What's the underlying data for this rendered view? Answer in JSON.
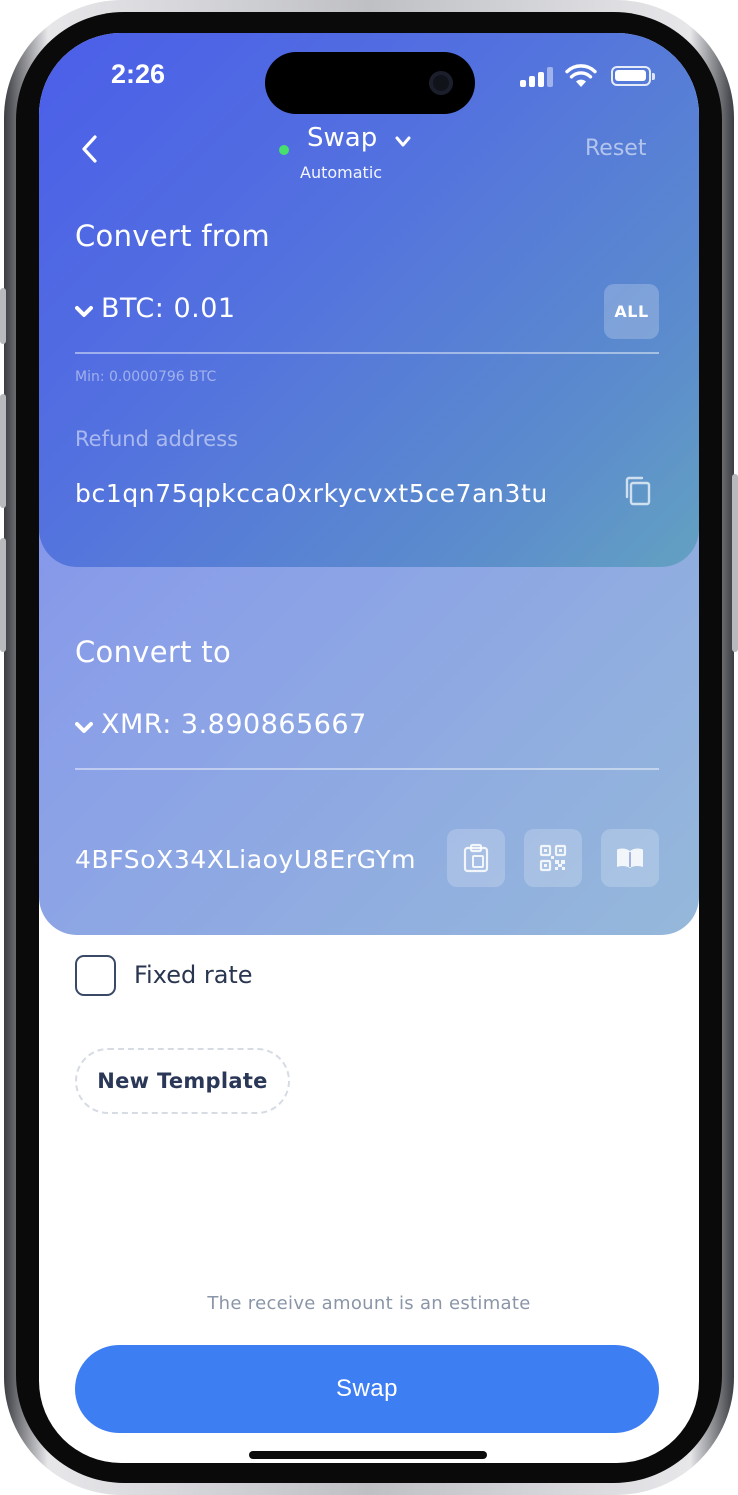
{
  "status_bar": {
    "time": "2:26"
  },
  "header": {
    "title": "Swap",
    "subtitle": "Automatic",
    "reset_label": "Reset",
    "status_color": "#47e06d"
  },
  "convert_from": {
    "title": "Convert from",
    "currency": "BTC",
    "amount_display": "BTC: 0.01",
    "all_label": "ALL",
    "min_text": "Min: 0.0000796 BTC",
    "refund_label": "Refund address",
    "refund_address": "bc1qn75qpkcca0xrkycvxt5ce7an3tu"
  },
  "convert_to": {
    "title": "Convert to",
    "currency": "XMR",
    "amount_display": "XMR: 3.890865667",
    "address": "4BFSoX34XLiaoyU8ErGYm"
  },
  "options": {
    "fixed_rate_label": "Fixed rate",
    "fixed_rate_checked": false,
    "new_template_label": "New Template"
  },
  "footer": {
    "estimate_note": "The receive amount is an estimate",
    "swap_label": "Swap",
    "accent_color": "#3d7ef3"
  },
  "icons": [
    "back-chevron-icon",
    "dropdown-chevron-icon",
    "copy-icon",
    "paste-icon",
    "qr-code-icon",
    "address-book-icon",
    "signal-icon",
    "wifi-icon",
    "battery-icon"
  ]
}
